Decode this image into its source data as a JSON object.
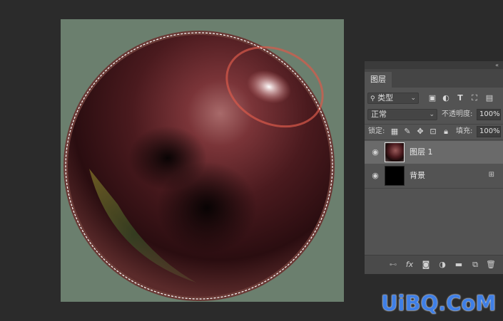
{
  "canvas": {
    "background": "#6b7f6e",
    "sphere_color": "#5a1e22",
    "selection": "marching-ants-circle"
  },
  "panel": {
    "tab_label": "图层",
    "collapse_icon": "«",
    "filter": {
      "icon": "search-icon",
      "label": "类型",
      "icons": [
        "image-filter-icon",
        "adjustment-filter-icon",
        "type-filter-icon",
        "shape-filter-icon",
        "smart-object-filter-icon"
      ]
    },
    "blend_mode": "正常",
    "opacity_label": "不透明度:",
    "opacity_value": "100%",
    "lock_label": "锁定:",
    "lock_icons": [
      "lock-transparent-icon",
      "lock-paint-icon",
      "lock-position-icon",
      "lock-artboard-icon",
      "lock-all-icon"
    ],
    "fill_label": "填充:",
    "fill_value": "100%",
    "layers": [
      {
        "name": "图层 1",
        "selected": true,
        "visible": true,
        "locked": false
      },
      {
        "name": "背景",
        "selected": false,
        "visible": true,
        "locked": true
      }
    ],
    "footer_icons": [
      "link-icon",
      "fx-icon",
      "mask-icon",
      "adjustment-icon",
      "folder-icon",
      "new-layer-icon",
      "trash-icon"
    ],
    "footer_fx_label": "fx"
  },
  "watermark": {
    "text": "UiBQ.CoM",
    "color": "#3f7fe6"
  }
}
